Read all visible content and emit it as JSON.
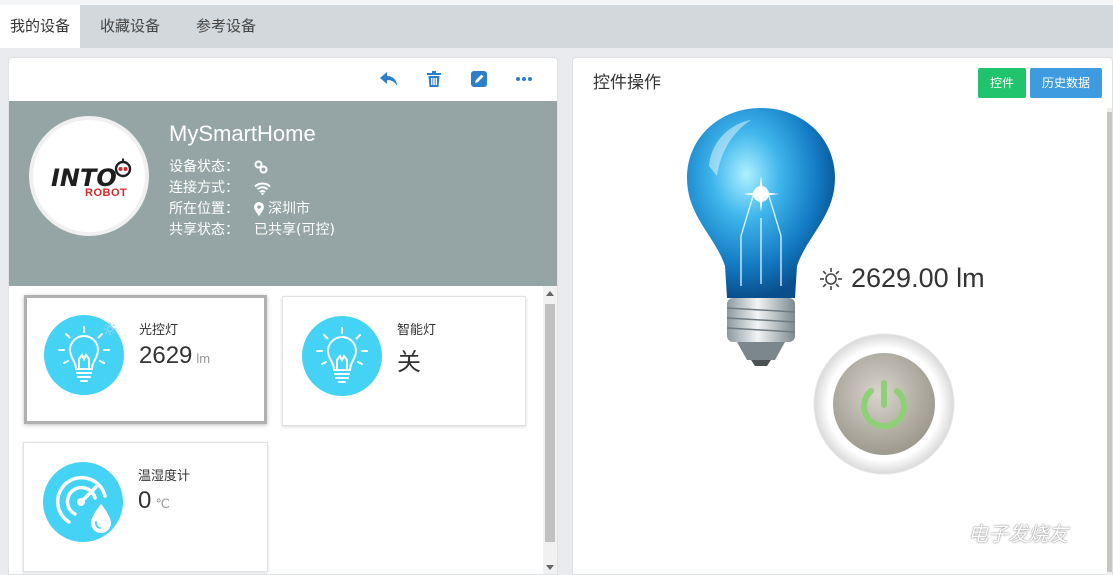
{
  "tabs": [
    {
      "label": "我的设备",
      "active": true
    },
    {
      "label": "收藏设备",
      "active": false
    },
    {
      "label": "参考设备",
      "active": false
    }
  ],
  "toolbar": {
    "icons": [
      "back-icon",
      "trash-icon",
      "edit-icon",
      "more-icon"
    ],
    "icon_color": "#2d7ec8"
  },
  "device": {
    "name": "MySmartHome",
    "logo": {
      "text": "INTO",
      "subtext": "ROBOT"
    },
    "status_label": "设备状态：",
    "connection_label": "连接方式：",
    "location_label": "所在位置：",
    "location_value": "深圳市",
    "share_label": "共享状态：",
    "share_value": "已共享(可控)",
    "header_color": "#95a5a5"
  },
  "cards": [
    {
      "title": "光控灯",
      "value": "2629",
      "unit": "lm",
      "icon": "light-bulb-icon",
      "selected": true
    },
    {
      "title": "智能灯",
      "value": "关",
      "unit": "",
      "icon": "light-bulb-icon",
      "selected": false
    },
    {
      "title": "温湿度计",
      "value": "0",
      "unit": "℃",
      "icon": "gauge-drop-icon",
      "selected": false
    }
  ],
  "control": {
    "title": "控件操作",
    "btn_control": "控件",
    "btn_history": "历史数据",
    "reading": "2629.00 lm",
    "accent_green": "#1fc46c",
    "accent_blue": "#3f9be0"
  },
  "watermark": "电子发烧友"
}
